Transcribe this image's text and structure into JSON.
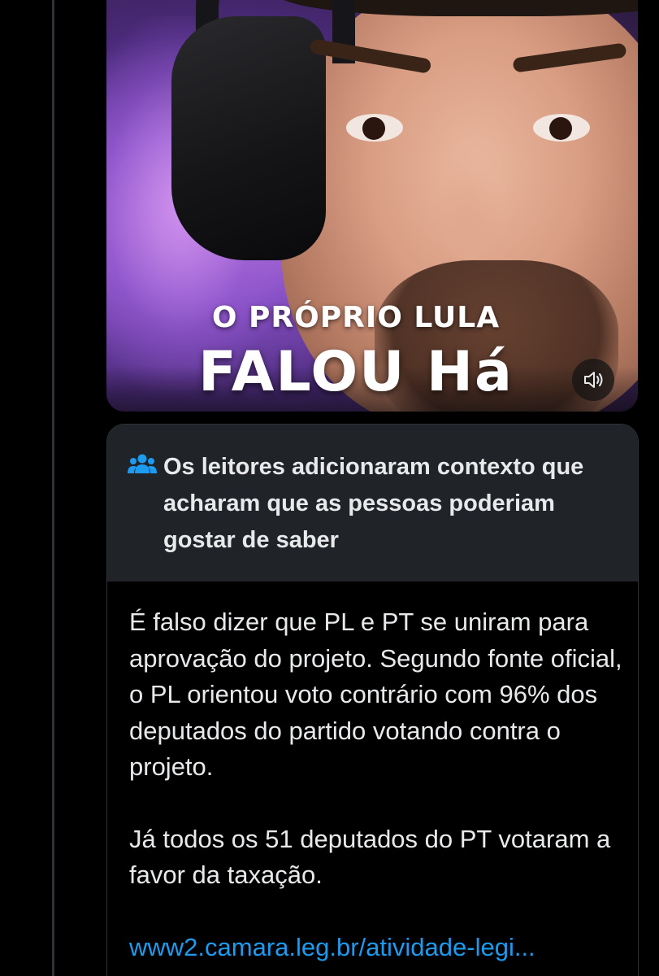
{
  "video": {
    "caption_line1": "O PRÓPRIO LULA",
    "caption_line2": "FALOU Há",
    "mute_icon": "speaker-muted-icon"
  },
  "community_note": {
    "icon": "people-icon",
    "title": "Os leitores adicionaram contexto que acharam que as pessoas poderiam gostar de saber",
    "paragraph1": "É falso dizer que PL e PT se uniram para aprovação do projeto. Segundo fonte oficial, o PL orientou voto contrário com 96% dos deputados do partido votando contra o projeto.",
    "paragraph2": "Já todos os 51 deputados do PT votaram a favor da taxação.",
    "link_text": "www2.camara.leg.br/atividade-legi..."
  },
  "colors": {
    "background": "#000000",
    "note_header_bg": "#202327",
    "text": "#e7e9ea",
    "link": "#1d9bf0",
    "icon_blue": "#1d9bf0",
    "border": "#2f3336"
  }
}
